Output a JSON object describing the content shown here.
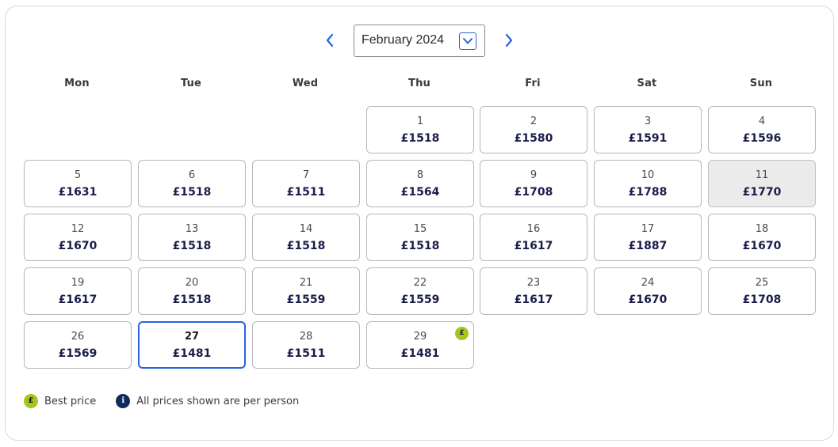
{
  "nav": {
    "month_label": "February 2024",
    "prev_icon": "chevron-left-icon",
    "next_icon": "chevron-right-icon",
    "dropdown_icon": "chevron-down-icon"
  },
  "weekdays": [
    "Mon",
    "Tue",
    "Wed",
    "Thu",
    "Fri",
    "Sat",
    "Sun"
  ],
  "days": [
    {
      "day": "1",
      "price": "£1518"
    },
    {
      "day": "2",
      "price": "£1580"
    },
    {
      "day": "3",
      "price": "£1591"
    },
    {
      "day": "4",
      "price": "£1596"
    },
    {
      "day": "5",
      "price": "£1631"
    },
    {
      "day": "6",
      "price": "£1518"
    },
    {
      "day": "7",
      "price": "£1511"
    },
    {
      "day": "8",
      "price": "£1564"
    },
    {
      "day": "9",
      "price": "£1708"
    },
    {
      "day": "10",
      "price": "£1788"
    },
    {
      "day": "11",
      "price": "£1770",
      "disabled": true
    },
    {
      "day": "12",
      "price": "£1670"
    },
    {
      "day": "13",
      "price": "£1518"
    },
    {
      "day": "14",
      "price": "£1518"
    },
    {
      "day": "15",
      "price": "£1518"
    },
    {
      "day": "16",
      "price": "£1617"
    },
    {
      "day": "17",
      "price": "£1887"
    },
    {
      "day": "18",
      "price": "£1670"
    },
    {
      "day": "19",
      "price": "£1617"
    },
    {
      "day": "20",
      "price": "£1518"
    },
    {
      "day": "21",
      "price": "£1559"
    },
    {
      "day": "22",
      "price": "£1559"
    },
    {
      "day": "23",
      "price": "£1617"
    },
    {
      "day": "24",
      "price": "£1670"
    },
    {
      "day": "25",
      "price": "£1708"
    },
    {
      "day": "26",
      "price": "£1569"
    },
    {
      "day": "27",
      "price": "£1481",
      "selected": true
    },
    {
      "day": "28",
      "price": "£1511"
    },
    {
      "day": "29",
      "price": "£1481",
      "best_price": true
    }
  ],
  "best_badge_symbol": "£",
  "colors": {
    "accent_blue": "#2b63d9",
    "best_price_green": "#a3c81a",
    "price_text": "#1b1d4a",
    "info_navy": "#102a5c",
    "disabled_bg": "#ebebeb"
  },
  "legend": {
    "best_symbol": "£",
    "best_label": "Best price",
    "info_symbol": "i",
    "info_label": "All prices shown are per person"
  }
}
